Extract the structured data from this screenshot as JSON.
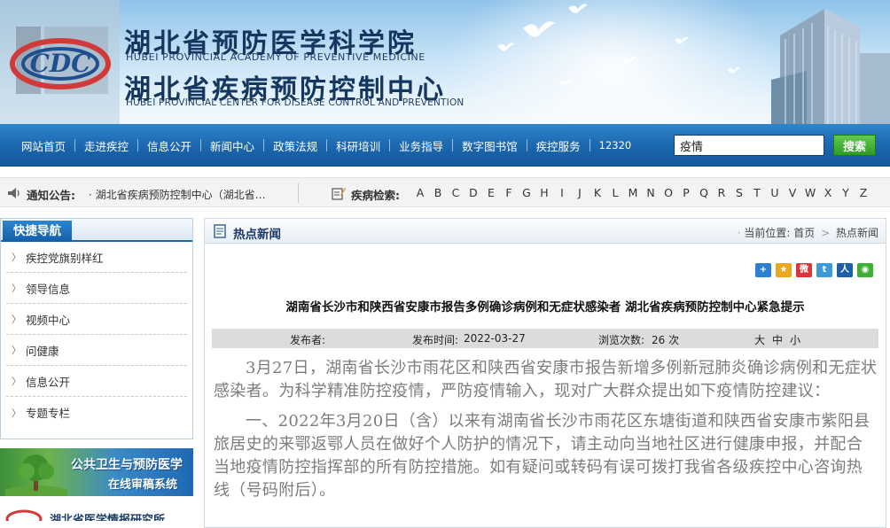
{
  "banner": {
    "title_cn_1": "湖北省预防医学科学院",
    "title_en_1": "HUBEI PROVINCIAL ACADEMY OF PREVENTIVE MEDICINE",
    "title_cn_2": "湖北省疾病预防控制中心",
    "title_en_2": "HUBEI PROVINCIAL CENTER FOR DISEASE CONTROL AND PREVENTION",
    "logo_text": "CDC"
  },
  "nav": {
    "items": [
      "网站首页",
      "走进疾控",
      "信息公开",
      "新闻中心",
      "政策法规",
      "科研培训",
      "业务指导",
      "数字图书馆",
      "疾控服务",
      "12320"
    ],
    "search_value": "疫情",
    "search_button": "搜索"
  },
  "notice": {
    "label": "通知公告:",
    "text": "· 湖北省疾病预防控制中心（湖北省预防医学科学院）",
    "disease_label": "疾病检索:",
    "letters": [
      "A",
      "B",
      "C",
      "D",
      "E",
      "F",
      "G",
      "H",
      "I",
      "J",
      "K",
      "L",
      "M",
      "N",
      "O",
      "P",
      "Q",
      "R",
      "S",
      "T",
      "U",
      "V",
      "W",
      "X",
      "Y",
      "Z"
    ]
  },
  "sidebar": {
    "title": "快捷导航",
    "items": [
      "疾控党旗别样红",
      "领导信息",
      "视频中心",
      "问健康",
      "信息公开",
      "专题专栏"
    ]
  },
  "ads": {
    "ad1_line1": "公共卫生与预防医学",
    "ad1_line2": "在线审稿系统",
    "ad2_text": "湖北省医学情报研究所"
  },
  "main": {
    "header_title": "热点新闻",
    "breadcrumb_label": "当前位置:",
    "breadcrumb_home": "首页",
    "breadcrumb_sep": ">",
    "breadcrumb_current": "热点新闻",
    "share_icons": [
      "plus-share-icon",
      "qzone-icon",
      "weibo-icon",
      "tencent-weibo-icon",
      "renren-icon",
      "wechat-icon"
    ],
    "article_title": "湖南省长沙市和陕西省安康市报告多例确诊病例和无症状感染者 湖北省疾病预防控制中心紧急提示",
    "meta": {
      "publisher_label": "发布者:",
      "time_label": "发布时间:",
      "time_value": "2022-03-27",
      "views_label": "浏览次数:",
      "views_value": "26 次",
      "font_large": "大",
      "font_medium": "中",
      "font_small": "小"
    },
    "paragraphs": [
      "3月27日，湖南省长沙市雨花区和陕西省安康市报告新增多例新冠肺炎确诊病例和无症状感染者。为科学精准防控疫情，严防疫情输入，现对广大群众提出如下疫情防控建议：",
      "一、2022年3月20日（含）以来有湖南省长沙市雨花区东塘街道和陕西省安康市紫阳县旅居史的来鄂返鄂人员在做好个人防护的情况下，请主动向当地社区进行健康申报，并配合当地疫情防控指挥部的所有防控措施。如有疑问或转码有误可拨打我省各级疾控中心咨询热线（号码附后）。"
    ]
  },
  "colors": {
    "nav_blue": "#1b66ad",
    "search_green": "#2e9a25",
    "title_navy": "#14365f",
    "article_gray": "#7c7c7c"
  }
}
